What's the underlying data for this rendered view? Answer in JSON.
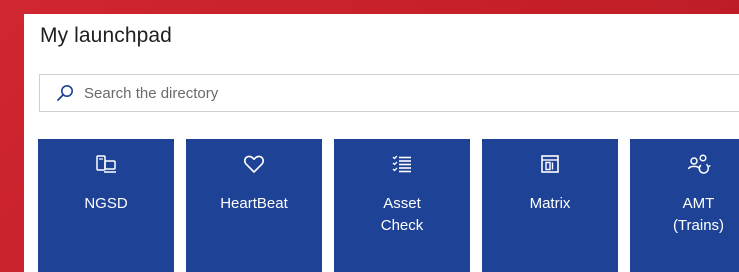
{
  "launchpad": {
    "title": "My launchpad",
    "search": {
      "placeholder": "Search the directory",
      "icon": "search-icon"
    },
    "tiles": [
      {
        "label": "NGSD",
        "icon": "devices-icon"
      },
      {
        "label": "HeartBeat",
        "icon": "heart-icon"
      },
      {
        "label": "Asset\nCheck",
        "icon": "checklist-icon"
      },
      {
        "label": "Matrix",
        "icon": "matrix-icon"
      },
      {
        "label": "AMT\n(Trains)",
        "icon": "people-sync-icon"
      }
    ]
  },
  "colors": {
    "background": "#c8222c",
    "panel": "#ffffff",
    "tile": "#1e4396",
    "tile_text": "#ffffff"
  }
}
